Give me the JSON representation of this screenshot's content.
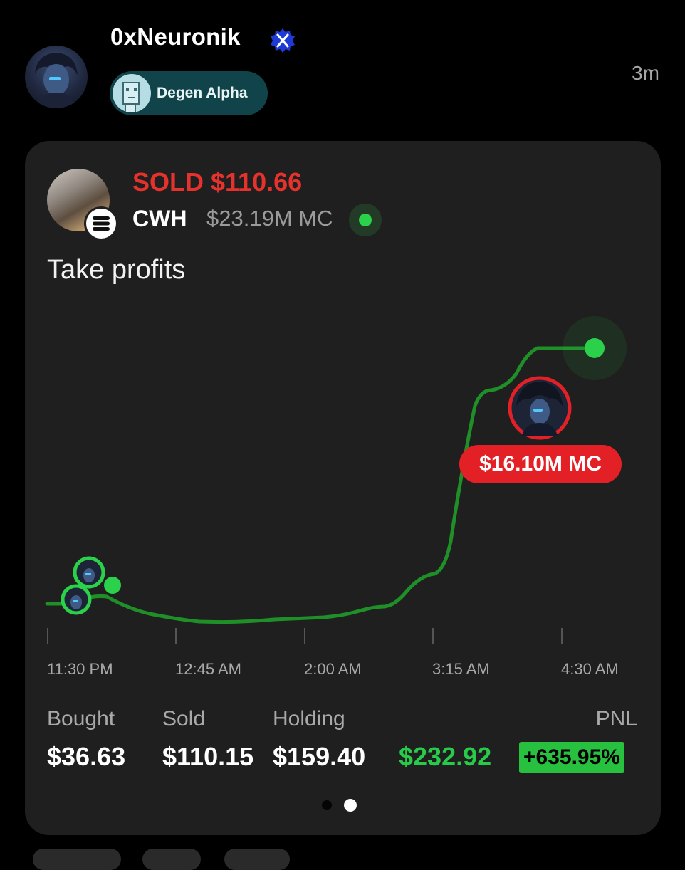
{
  "header": {
    "username": "0xNeuronik",
    "badge_label": "Degen Alpha",
    "time_ago": "3m"
  },
  "trade": {
    "action_text": "SOLD $110.66",
    "ticker": "CWH",
    "market_cap": "$23.19M MC",
    "caption": "Take profits"
  },
  "chart": {
    "x_ticks": [
      "11:30 PM",
      "12:45 AM",
      "2:00 AM",
      "3:15 AM",
      "4:30 AM"
    ],
    "sell_marker_label": "$16.10M MC",
    "line_color": "#1f8f27",
    "accent_color": "#2bd14a"
  },
  "stats": {
    "bought_label": "Bought",
    "bought_value": "$36.63",
    "sold_label": "Sold",
    "sold_value": "$110.15",
    "holding_label": "Holding",
    "holding_value": "$159.40",
    "pnl_label": "PNL",
    "pnl_value": "$232.92",
    "pnl_percent": "+635.95%"
  },
  "pagination": {
    "pages": 2,
    "active": 2
  },
  "colors": {
    "sold_red": "#e5322c",
    "positive_green": "#29c94a",
    "card_bg": "#1f1f1f",
    "badge_bg": "#10434a"
  }
}
